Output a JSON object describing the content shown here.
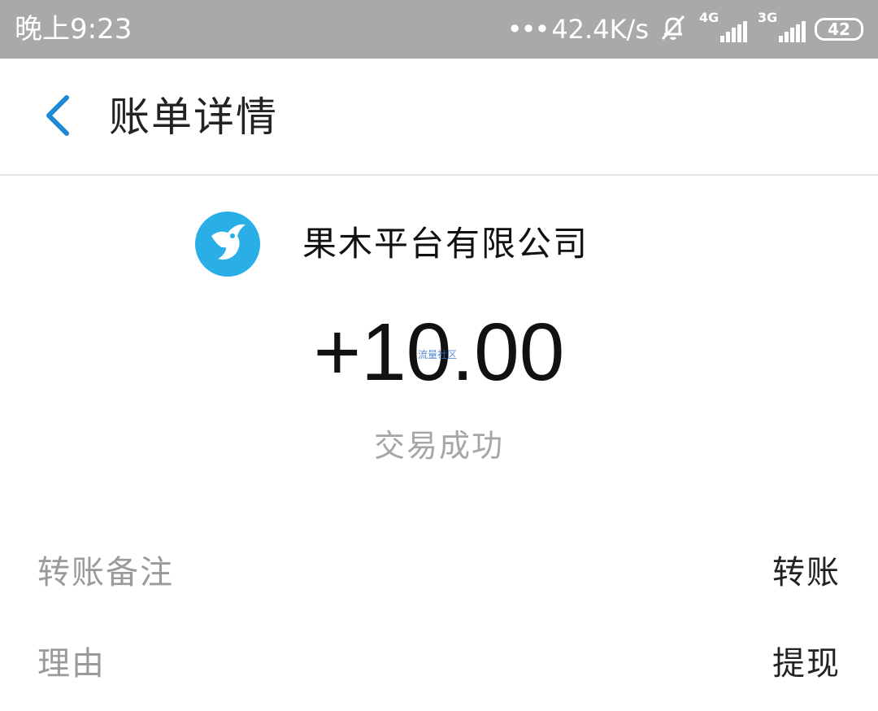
{
  "status_bar": {
    "time": "晚上9:23",
    "dots": "•••",
    "network_speed": "42.4K/s",
    "network_1": "4G",
    "network_2": "3G",
    "battery": "42",
    "icons": [
      "mute-bell-icon",
      "signal-4g-icon",
      "signal-3g-icon",
      "battery-icon"
    ]
  },
  "app_bar": {
    "title": "账单详情",
    "back_icon": "chevron-left-icon",
    "accent_color": "#1e8ad6"
  },
  "merchant": {
    "name": "果木平台有限公司",
    "logo_icon": "bird-logo-icon",
    "logo_color": "#2aaee8"
  },
  "transaction": {
    "amount": "+10.00",
    "watermark": "流量社区",
    "status": "交易成功"
  },
  "details": [
    {
      "label": "转账备注",
      "value": "转账"
    },
    {
      "label": "理由",
      "value": "提现"
    }
  ]
}
